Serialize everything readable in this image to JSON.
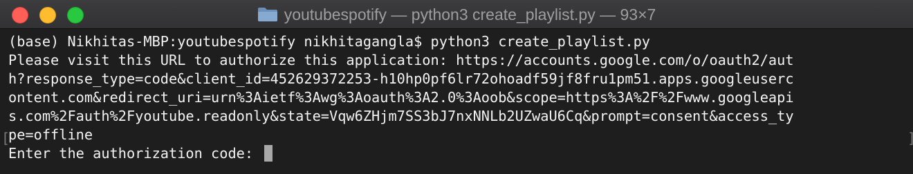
{
  "window": {
    "title": "youtubespotify — python3 create_playlist.py — 93×7",
    "icon": "folder-icon",
    "buttons": {
      "close": "close-button",
      "minimize": "minimize-button",
      "zoom": "zoom-button"
    }
  },
  "terminal": {
    "lines": [
      "(base) Nikhitas-MBP:youtubespotify nikhitagangla$ python3 create_playlist.py",
      "Please visit this URL to authorize this application: https://accounts.google.com/o/oauth2/aut",
      "h?response_type=code&client_id=452629372253-h10hp0pf6lr72ohoadf59jf8fru1pm51.apps.googleuserc",
      "ontent.com&redirect_uri=urn%3Aietf%3Awg%3Aoauth%3A2.0%3Aoob&scope=https%3A%2F%2Fwww.googleapi",
      "s.com%2Fauth%2Fyoutube.readonly&state=Vqw6ZHjm7SS3bJ7nxNNLb2UZwaU6Cq&prompt=consent&access_ty",
      "pe=offline"
    ],
    "prompt": "Enter the authorization code: ",
    "input_value": ""
  },
  "colors": {
    "background": "#1e1e1e",
    "text": "#f2f2f2",
    "titlebar": "#38383a",
    "title_text": "#9e9ea0",
    "close": "#ff5f57",
    "minimize": "#febc2e",
    "zoom": "#28c840",
    "cursor": "#a8a8a8"
  }
}
